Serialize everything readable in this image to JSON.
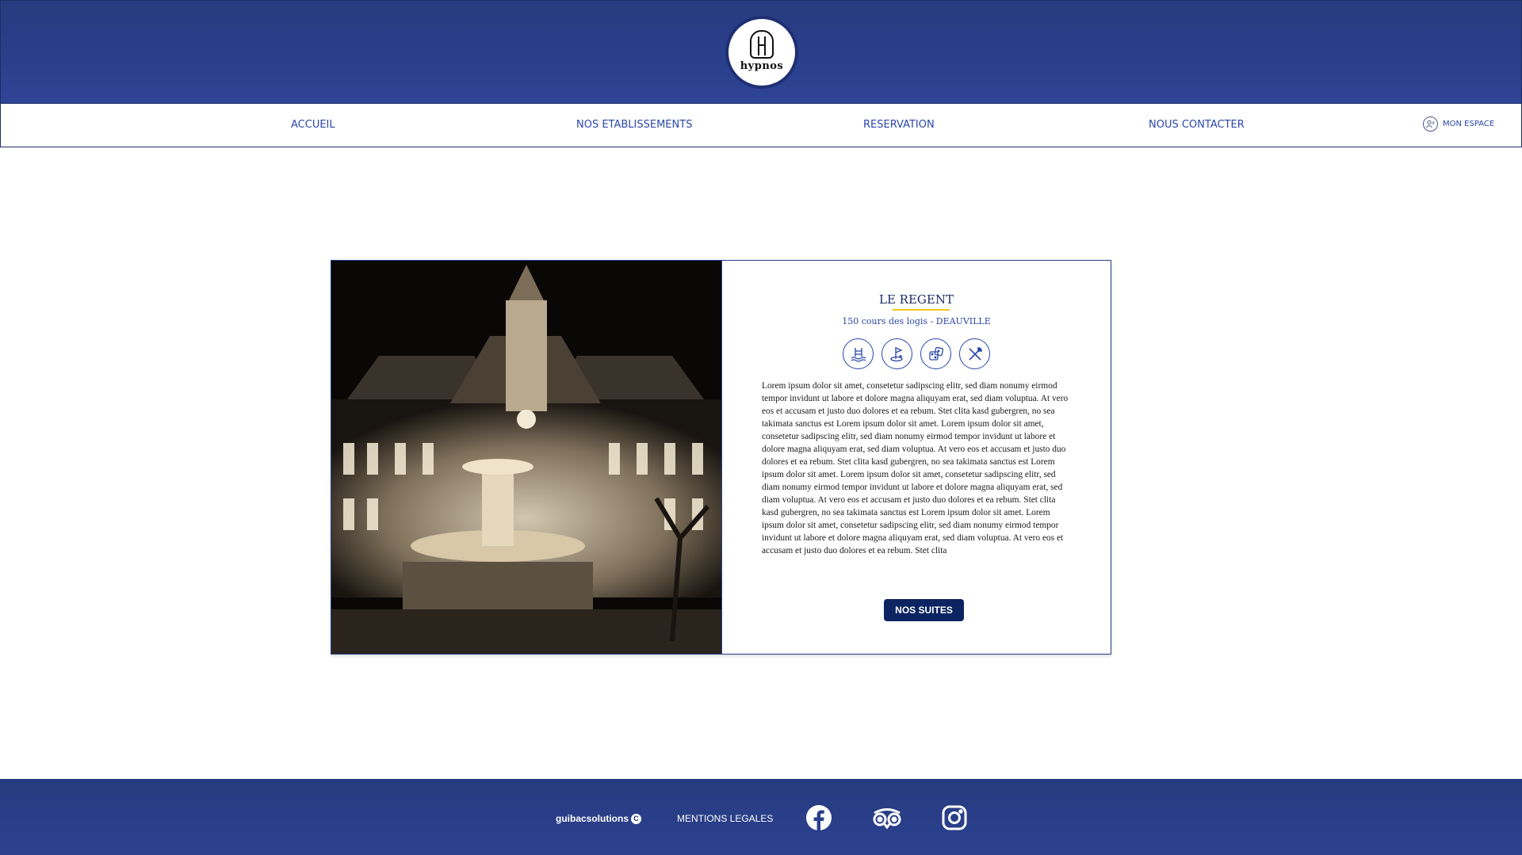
{
  "header": {
    "logo_text": "hypnos",
    "bg_color": "#2a3f8c"
  },
  "nav": {
    "items": [
      {
        "label": "ACCUEIL"
      },
      {
        "label": "NOS ETABLISSEMENTS"
      },
      {
        "label": "RESERVATION"
      },
      {
        "label": "NOUS CONTACTER"
      }
    ],
    "account_label": "MON ESPACE",
    "text_color": "#2a47a8"
  },
  "hotel": {
    "name": "LE REGENT",
    "address": "150 cours des logis - DEAUVILLE",
    "amenities": [
      "pool-icon",
      "golf-icon",
      "casino-dice-icon",
      "restaurant-icon"
    ],
    "description": "Lorem ipsum dolor sit amet, consetetur sadipscing elitr, sed diam nonumy eirmod tempor invidunt ut labore et dolore magna aliquyam erat, sed diam voluptua. At vero eos et accusam et justo duo dolores et ea rebum. Stet clita kasd gubergren, no sea takimata sanctus est Lorem ipsum dolor sit amet. Lorem ipsum dolor sit amet, consetetur sadipscing elitr, sed diam nonumy eirmod tempor invidunt ut labore et dolore magna aliquyam erat, sed diam voluptua. At vero eos et accusam et justo duo dolores et ea rebum. Stet clita kasd gubergren, no sea takimata sanctus est Lorem ipsum dolor sit amet. Lorem ipsum dolor sit amet, consetetur sadipscing elitr, sed diam nonumy eirmod tempor invidunt ut labore et dolore magna aliquyam erat, sed diam voluptua. At vero eos et accusam et justo duo dolores et ea rebum. Stet clita kasd gubergren, no sea takimata sanctus est Lorem ipsum dolor sit amet. Lorem ipsum dolor sit amet, consetetur sadipscing elitr, sed diam nonumy eirmod tempor invidunt ut labore et dolore magna aliquyam erat, sed diam voluptua. At vero eos et accusam et justo duo dolores et ea rebum. Stet clita",
    "button_label": "NOS SUITES",
    "accent_color": "#f0c419",
    "button_color": "#0c2461"
  },
  "footer": {
    "copyright": "guibacsolutions",
    "copyright_symbol": "C",
    "legal_label": "MENTIONS LEGALES",
    "social": [
      "facebook-icon",
      "tripadvisor-icon",
      "instagram-icon"
    ]
  }
}
